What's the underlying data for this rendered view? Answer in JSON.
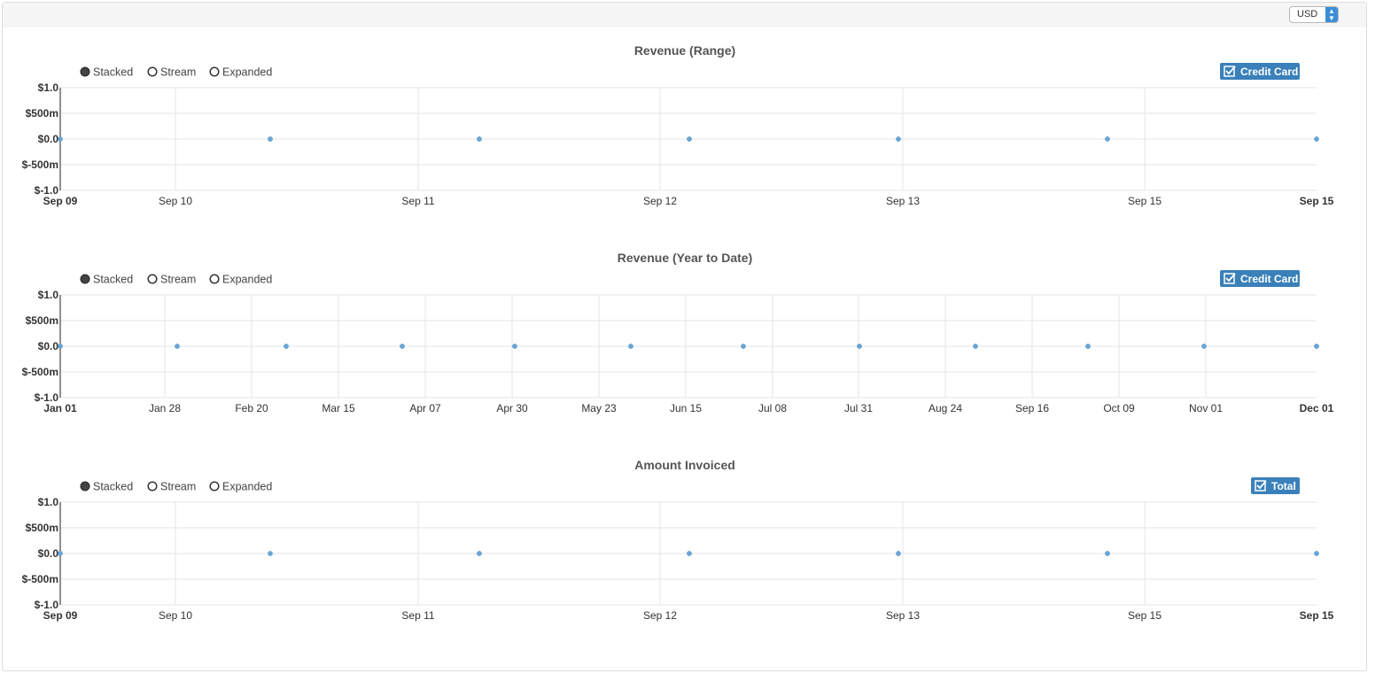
{
  "currency": {
    "selected": "USD"
  },
  "legend_options": [
    "Stacked",
    "Stream",
    "Expanded"
  ],
  "chart_data": [
    {
      "type": "scatter",
      "title": "Revenue (Range)",
      "legend_button": "Credit Card",
      "yticks": [
        "$1.0",
        "$500m",
        "$0.0",
        "$-500m",
        "$-1.0"
      ],
      "ylim": [
        -1.0,
        1.0
      ],
      "xticks": [
        "Sep 09",
        "Sep 10",
        "Sep 11",
        "Sep 12",
        "Sep 13",
        "Sep 15",
        "Sep 15"
      ],
      "series": [
        {
          "name": "Credit Card",
          "values": [
            0,
            0,
            0,
            0,
            0,
            0,
            0
          ]
        }
      ]
    },
    {
      "type": "scatter",
      "title": "Revenue (Year to Date)",
      "legend_button": "Credit Card",
      "yticks": [
        "$1.0",
        "$500m",
        "$0.0",
        "$-500m",
        "$-1.0"
      ],
      "ylim": [
        -1.0,
        1.0
      ],
      "xticks": [
        "Jan 01",
        "Jan 28",
        "Feb 20",
        "Mar 15",
        "Apr 07",
        "Apr 30",
        "May 23",
        "Jun 15",
        "Jul 08",
        "Jul 31",
        "Aug 24",
        "Sep 16",
        "Oct 09",
        "Nov 01",
        "Dec 01"
      ],
      "series": [
        {
          "name": "Credit Card",
          "values": [
            0,
            0,
            0,
            0,
            0,
            0,
            0,
            0,
            0,
            0,
            0,
            0
          ]
        }
      ]
    },
    {
      "type": "scatter",
      "title": "Amount Invoiced",
      "legend_button": "Total",
      "yticks": [
        "$1.0",
        "$500m",
        "$0.0",
        "$-500m",
        "$-1.0"
      ],
      "ylim": [
        -1.0,
        1.0
      ],
      "xticks": [
        "Sep 09",
        "Sep 10",
        "Sep 11",
        "Sep 12",
        "Sep 13",
        "Sep 15",
        "Sep 15"
      ],
      "series": [
        {
          "name": "Total",
          "values": [
            0,
            0,
            0,
            0,
            0,
            0,
            0
          ]
        }
      ]
    }
  ]
}
